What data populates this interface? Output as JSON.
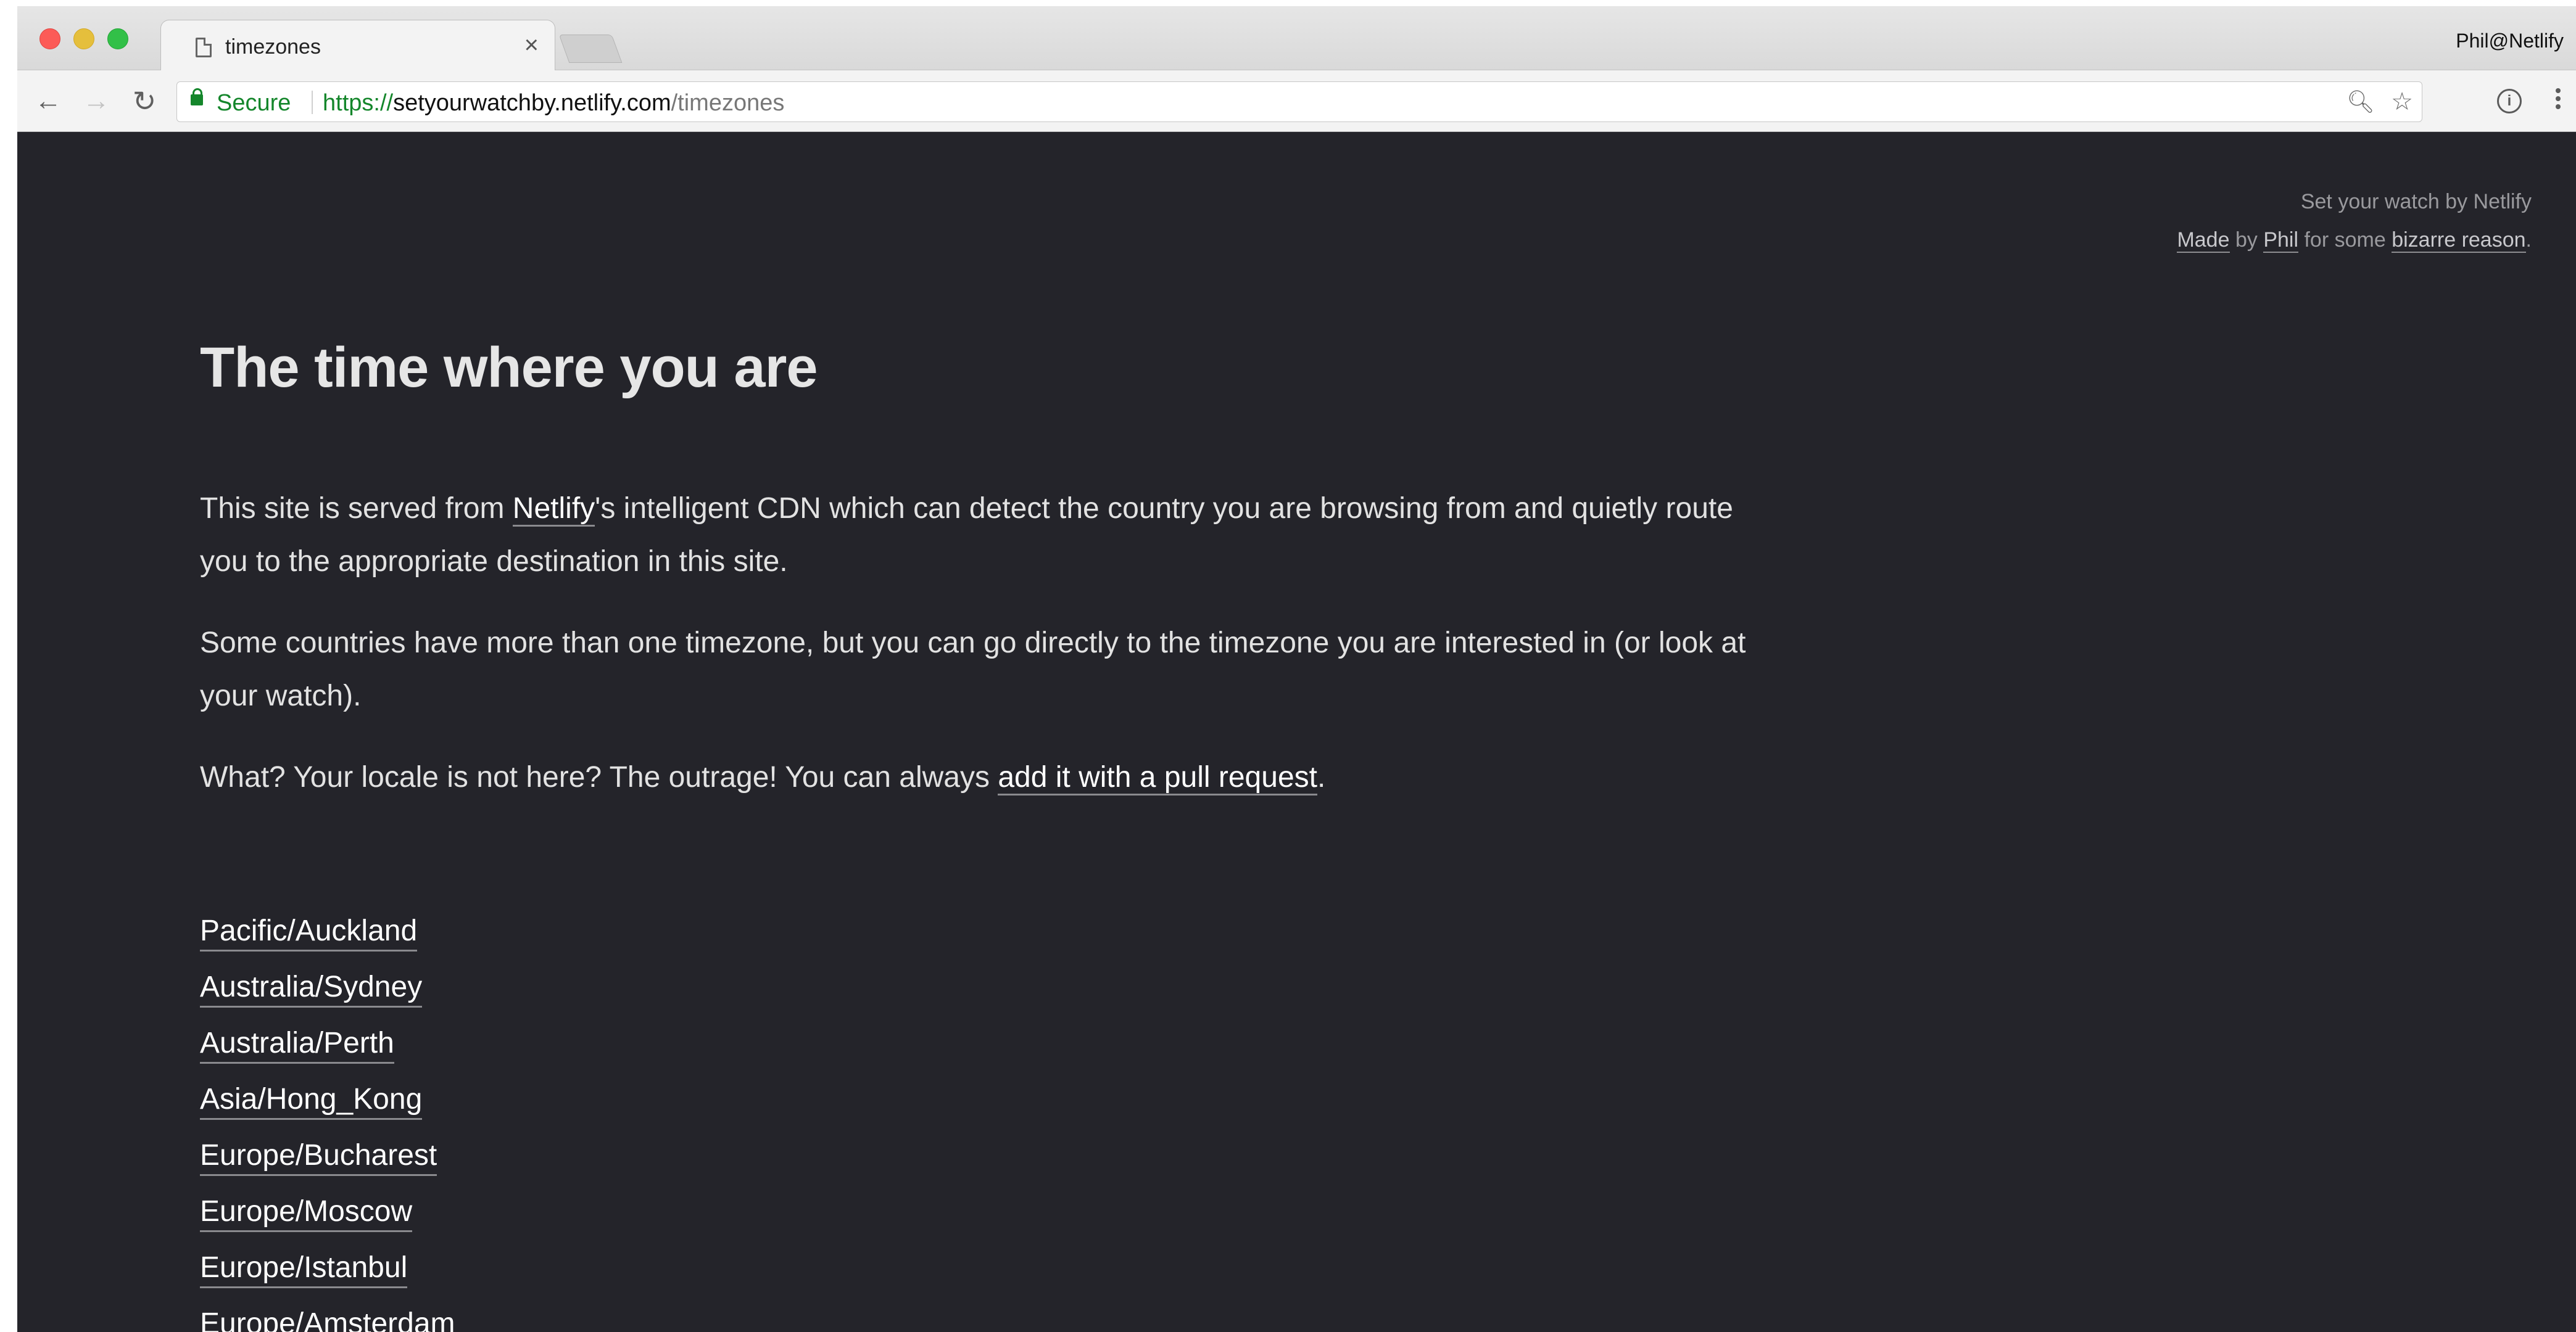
{
  "browser": {
    "tab_title": "timezones",
    "tab_close": "×",
    "profile_name": "Phil@Netlify",
    "secure_label": "Secure",
    "url_scheme": "https://",
    "url_host": "setyourwatchby.netlify.com",
    "url_path": "/timezones",
    "icons": {
      "back": "arrow-left",
      "forward": "arrow-right",
      "reload": "reload",
      "zoom": "magnifier",
      "bookmark": "star",
      "info": "info",
      "menu": "vertical-dots"
    }
  },
  "page": {
    "header_line1": "Set your watch by Netlify",
    "made_link": "Made",
    "by_text": "by",
    "phil_link": "Phil",
    "for_some_text": "for some",
    "reason_link": "bizarre reason",
    "period": ".",
    "title": "The time where you are",
    "p1_before": "This site is served from ",
    "p1_link": "Netlify",
    "p1_after": "'s intelligent CDN which can detect the country you are browsing from and quietly route you to the appropriate destination in this site.",
    "p2": "Some countries have more than one timezone, but you can go directly to the timezone you are interested in (or look at your watch).",
    "p3_before": "What? Your locale is not here? The outrage! You can always ",
    "p3_link": "add it with a pull request",
    "p3_after": ".",
    "timezones": [
      "Pacific/Auckland",
      "Australia/Sydney",
      "Australia/Perth",
      "Asia/Hong_Kong",
      "Europe/Bucharest",
      "Europe/Moscow",
      "Europe/Istanbul",
      "Europe/Amsterdam"
    ]
  },
  "colors": {
    "page_background": "#24242a",
    "secure_green": "#14862b",
    "link_text": "#ffffff"
  }
}
